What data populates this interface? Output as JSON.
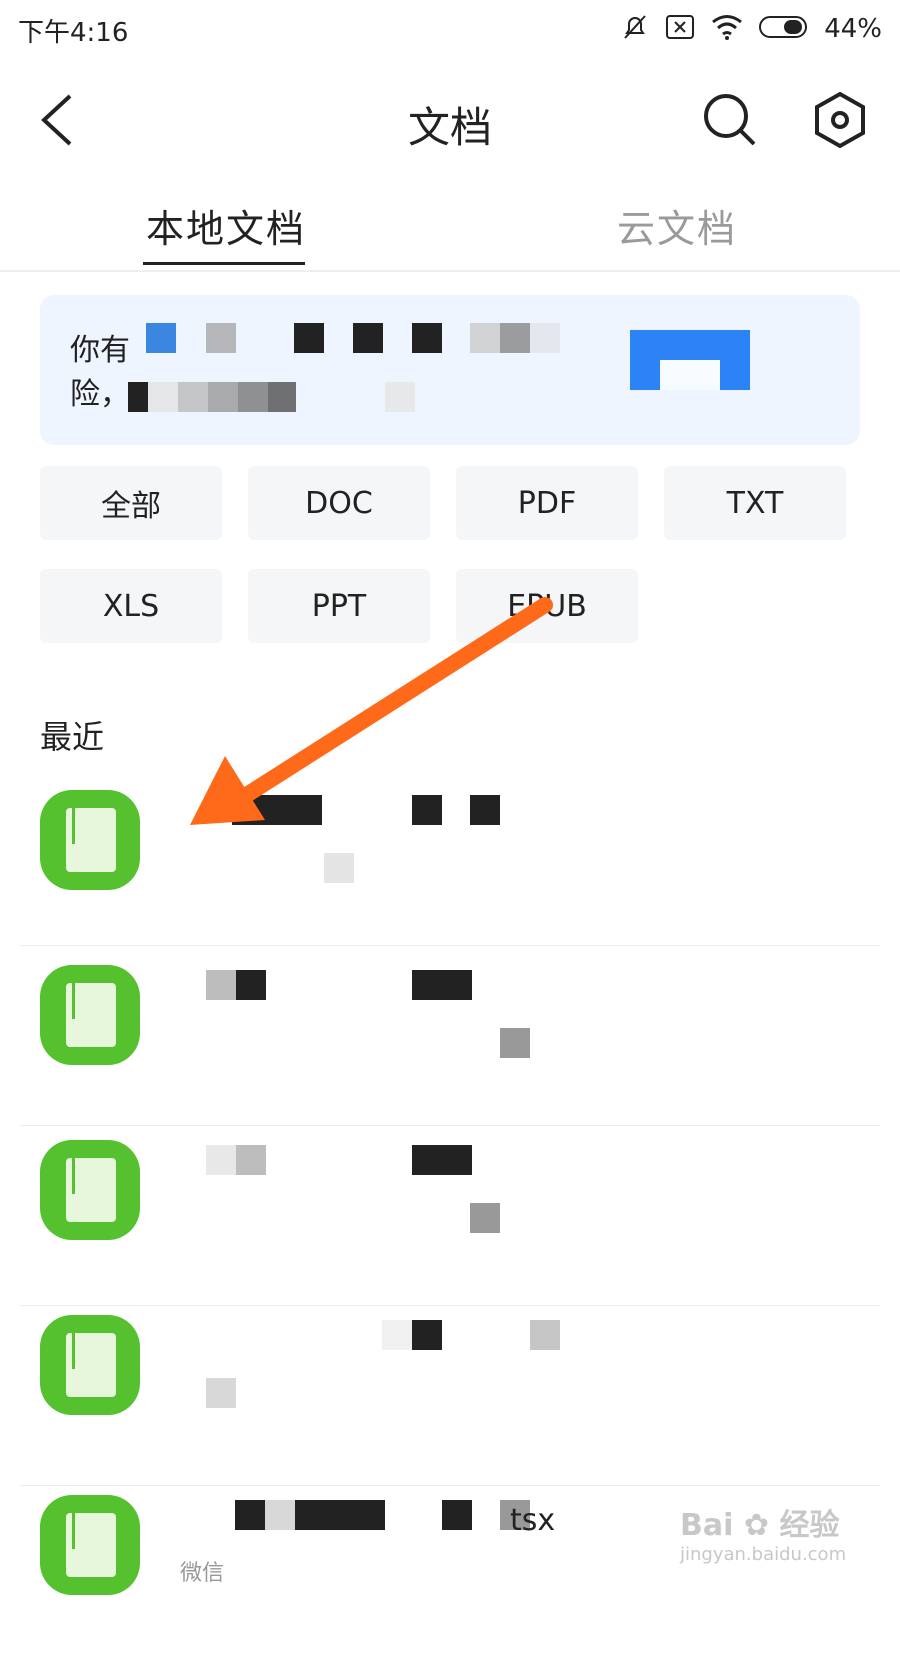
{
  "status_bar": {
    "time": "下午4:16",
    "battery_percent": "44%",
    "icons": [
      "bell-muted-icon",
      "sim-x-icon",
      "wifi-icon",
      "battery-icon"
    ]
  },
  "header": {
    "title": "文档",
    "icons": [
      "back-icon",
      "search-icon",
      "settings-hex-icon"
    ]
  },
  "tabs": [
    {
      "label": "本地文档",
      "active": true
    },
    {
      "label": "云文档",
      "active": false
    }
  ],
  "banner": {
    "line1": "你有",
    "line2": "险，"
  },
  "filters": [
    "全部",
    "DOC",
    "PDF",
    "TXT",
    "XLS",
    "PPT",
    "EPUB"
  ],
  "recent": {
    "title": "最近",
    "items": [
      {
        "icon": "excel-icon",
        "title": "",
        "meta": ""
      },
      {
        "icon": "excel-icon",
        "title": "",
        "meta": ""
      },
      {
        "icon": "excel-icon",
        "title": "",
        "meta": ""
      },
      {
        "icon": "excel-icon",
        "title": "",
        "meta": ""
      },
      {
        "icon": "excel-icon",
        "title": "tsx",
        "meta": "微信"
      }
    ]
  },
  "watermark": {
    "brand": "Bai",
    "site": "jingyan.baidu.com",
    "label": "经验"
  },
  "colors": {
    "accent": "#2c82f7",
    "banner_bg": "#eef5ff",
    "excel_green": "#56c12e",
    "arrow": "#ff6a1a"
  }
}
